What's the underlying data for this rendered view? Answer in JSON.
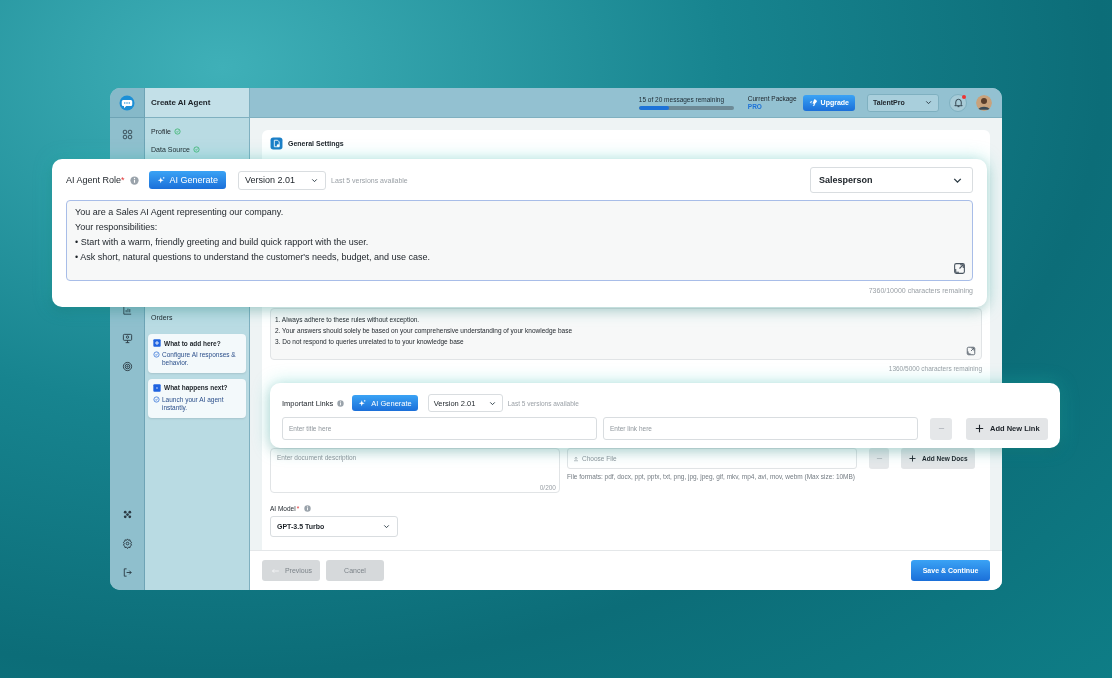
{
  "app": {
    "title": "Create AI Agent"
  },
  "header": {
    "usage": {
      "text": "15 of 20 messages remaining",
      "level": 0.32
    },
    "package_label": "Current Package",
    "package": "PRO",
    "upgrade": "Upgrade",
    "account": "TalentPro",
    "unread": true
  },
  "steps": [
    {
      "label": "Profile",
      "done": true
    },
    {
      "label": "Data Source",
      "done": true
    }
  ],
  "lower_steps": [
    {
      "label": "Orders",
      "done": false
    }
  ],
  "tips": [
    {
      "kind": "add",
      "title": "What to add here?",
      "text": "Configure AI responses & behavior."
    },
    {
      "kind": "next",
      "title": "What happens next?",
      "text": "Launch your AI agent instantly."
    }
  ],
  "section": {
    "title": "General Settings"
  },
  "rules": {
    "lines": [
      "1. Always adhere to these rules without exception.",
      "2. Your answers should solely be based on your comprehensive understanding of your knowledge base",
      "3. Do not respond to queries unrelated to to your knowledge base"
    ],
    "counter": "1360/5000 characters remaining"
  },
  "documents": {
    "placeholder": "Enter document description",
    "counter": "0/200",
    "file": "Choose File",
    "formats": "File formats: pdf, docx, ppt, pptx, txt, png, jpg, jpeg, gif, mkv, mp4, avi, mov, webm (Max size: 10MB)",
    "add": "Add New Docs"
  },
  "model": {
    "label": "AI Model",
    "required_mark": "*",
    "value": "GPT-3.5 Turbo"
  },
  "footer": {
    "buttons": [
      {
        "label": "Previous",
        "kind": "back",
        "disabled": true
      },
      {
        "label": "Cancel",
        "kind": "plain",
        "disabled": true
      },
      {
        "label": "Save & Continue",
        "kind": "primary",
        "disabled": false
      }
    ]
  },
  "role_card": {
    "label": "AI Agent Role",
    "required_mark": "*",
    "generate": "AI Generate",
    "version": "Version 2.01",
    "versions_note": "Last 5 versions available",
    "role": "Salesperson",
    "lines": [
      "You are a Sales AI Agent representing our company.",
      "Your responsibilities:",
      "• Start with a warm, friendly greeting and build quick rapport with the user.",
      "• Ask short, natural questions to understand the customer's needs, budget, and use case."
    ],
    "counter": "7360/10000 characters remaining"
  },
  "links_card": {
    "label": "Important Links",
    "generate": "AI Generate",
    "version": "Version 2.01",
    "versions_note": "Last 5 versions available",
    "title_placeholder": "Enter title here",
    "link_placeholder": "Enter link here",
    "add": "Add New Link"
  }
}
